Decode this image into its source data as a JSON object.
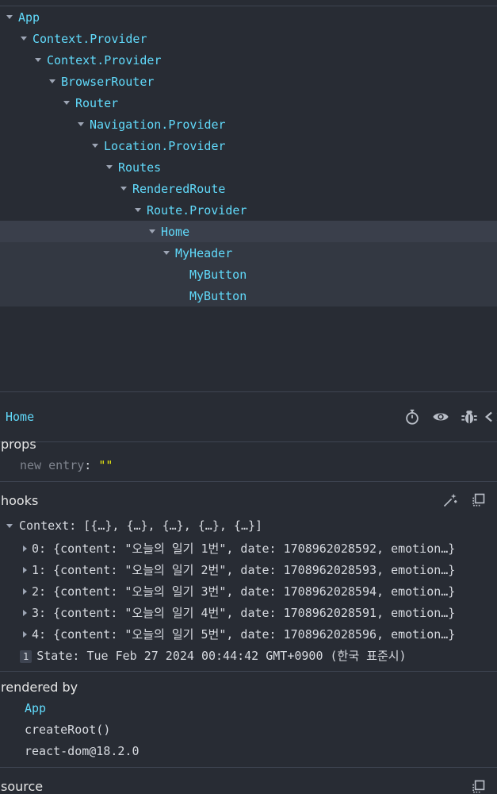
{
  "tree": [
    {
      "label": "App",
      "depth": 0,
      "expanded": true
    },
    {
      "label": "Context.Provider",
      "depth": 1,
      "expanded": true
    },
    {
      "label": "Context.Provider",
      "depth": 2,
      "expanded": true
    },
    {
      "label": "BrowserRouter",
      "depth": 3,
      "expanded": true
    },
    {
      "label": "Router",
      "depth": 4,
      "expanded": true
    },
    {
      "label": "Navigation.Provider",
      "depth": 5,
      "expanded": true
    },
    {
      "label": "Location.Provider",
      "depth": 6,
      "expanded": true
    },
    {
      "label": "Routes",
      "depth": 7,
      "expanded": true
    },
    {
      "label": "RenderedRoute",
      "depth": 8,
      "expanded": true
    },
    {
      "label": "Route.Provider",
      "depth": 9,
      "expanded": true
    },
    {
      "label": "Home",
      "depth": 10,
      "expanded": true,
      "state": "selected"
    },
    {
      "label": "MyHeader",
      "depth": 11,
      "expanded": true,
      "state": "sub"
    },
    {
      "label": "MyButton",
      "depth": 12,
      "expanded": false,
      "state": "sub"
    },
    {
      "label": "MyButton",
      "depth": 12,
      "expanded": false,
      "state": "sub"
    }
  ],
  "inspector": {
    "title": "Home",
    "icons": [
      "stopwatch-icon",
      "eye-icon",
      "bug-icon",
      "code-icon"
    ],
    "props": {
      "title": "props",
      "new_entry_label": "new entry",
      "colon": ":",
      "new_entry_value": "\"\""
    },
    "hooks": {
      "title": "hooks",
      "context_label": "Context:",
      "context_value": "[{…}, {…}, {…}, {…}, {…}]",
      "entries": [
        {
          "key": "0:",
          "value": "{content: \"오늘의 일기 1번\", date: 1708962028592, emotion…}"
        },
        {
          "key": "1:",
          "value": "{content: \"오늘의 일기 2번\", date: 1708962028593, emotion…}"
        },
        {
          "key": "2:",
          "value": "{content: \"오늘의 일기 3번\", date: 1708962028594, emotion…}"
        },
        {
          "key": "3:",
          "value": "{content: \"오늘의 일기 4번\", date: 1708962028591, emotion…}"
        },
        {
          "key": "4:",
          "value": "{content: \"오늘의 일기 5번\", date: 1708962028596, emotion…}"
        }
      ],
      "state_index": "1",
      "state_label": "State:",
      "state_value": "Tue Feb 27 2024 00:44:42 GMT+0900 (한국 표준시)"
    },
    "rendered_by": {
      "title": "rendered by",
      "items": [
        "App",
        "createRoot()",
        "react-dom@18.2.0"
      ]
    },
    "source": {
      "title": "source"
    }
  },
  "colors": {
    "background": "#282c34",
    "component": "#61dafb",
    "string": "#e5e510",
    "muted": "#7f848e"
  }
}
